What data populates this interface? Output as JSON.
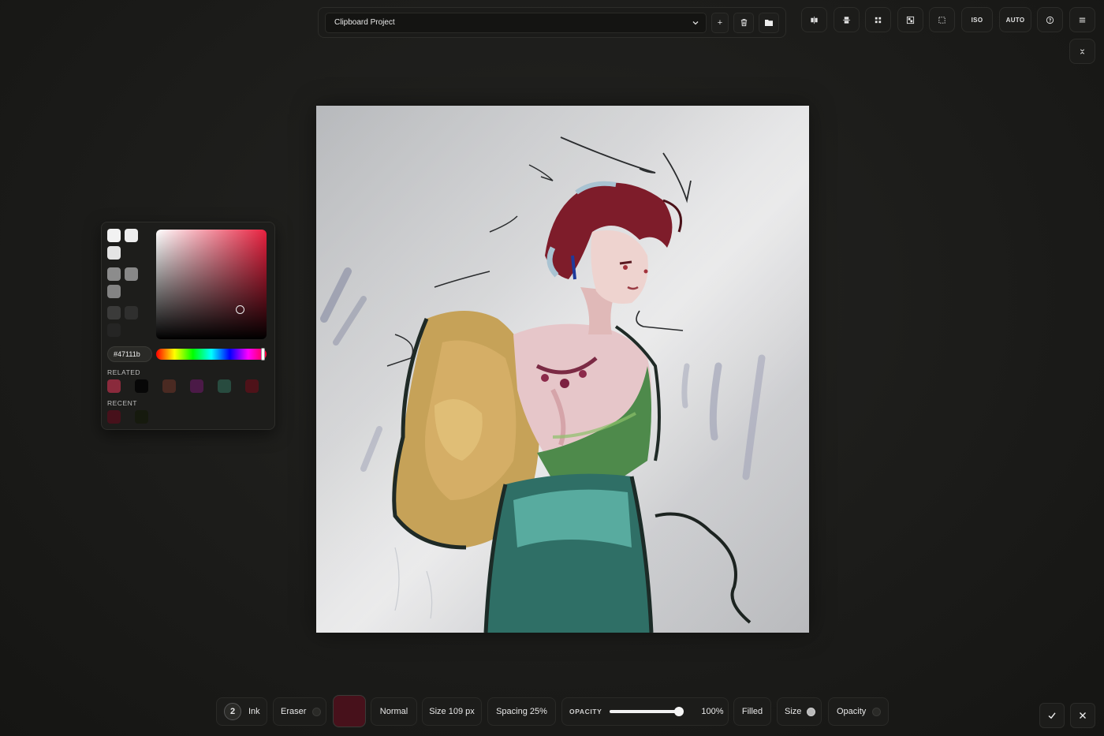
{
  "project": {
    "name": "Clipboard Project",
    "add_label": "+"
  },
  "toolbar": {
    "iso_label": "ISO",
    "auto_label": "AUTO"
  },
  "color_picker": {
    "hex_value": "#47111b",
    "related_label": "RELATED",
    "recent_label": "RECENT",
    "saturation": 0.85,
    "brightness": 0.28,
    "hue_position": 0.96,
    "related_colors": [
      "#8a2a3c",
      "#070707",
      "#4a2a22",
      "#4b1a47",
      "#284b3f",
      "#4e1219"
    ],
    "recent_colors": [
      "#47111b",
      "#161a0e"
    ]
  },
  "bottom_bar": {
    "layer_number": "2",
    "brush_label": "Ink",
    "eraser_label": "Eraser",
    "current_color": "#47111b",
    "blend_mode": "Normal",
    "size_label": "Size 109 px",
    "spacing_label": "Spacing 25%",
    "opacity_label": "OPACITY",
    "opacity_value": "100%",
    "opacity_fraction": 1.0,
    "filled_label": "Filled",
    "size_toggle_label": "Size",
    "opacity_toggle_label": "Opacity"
  }
}
